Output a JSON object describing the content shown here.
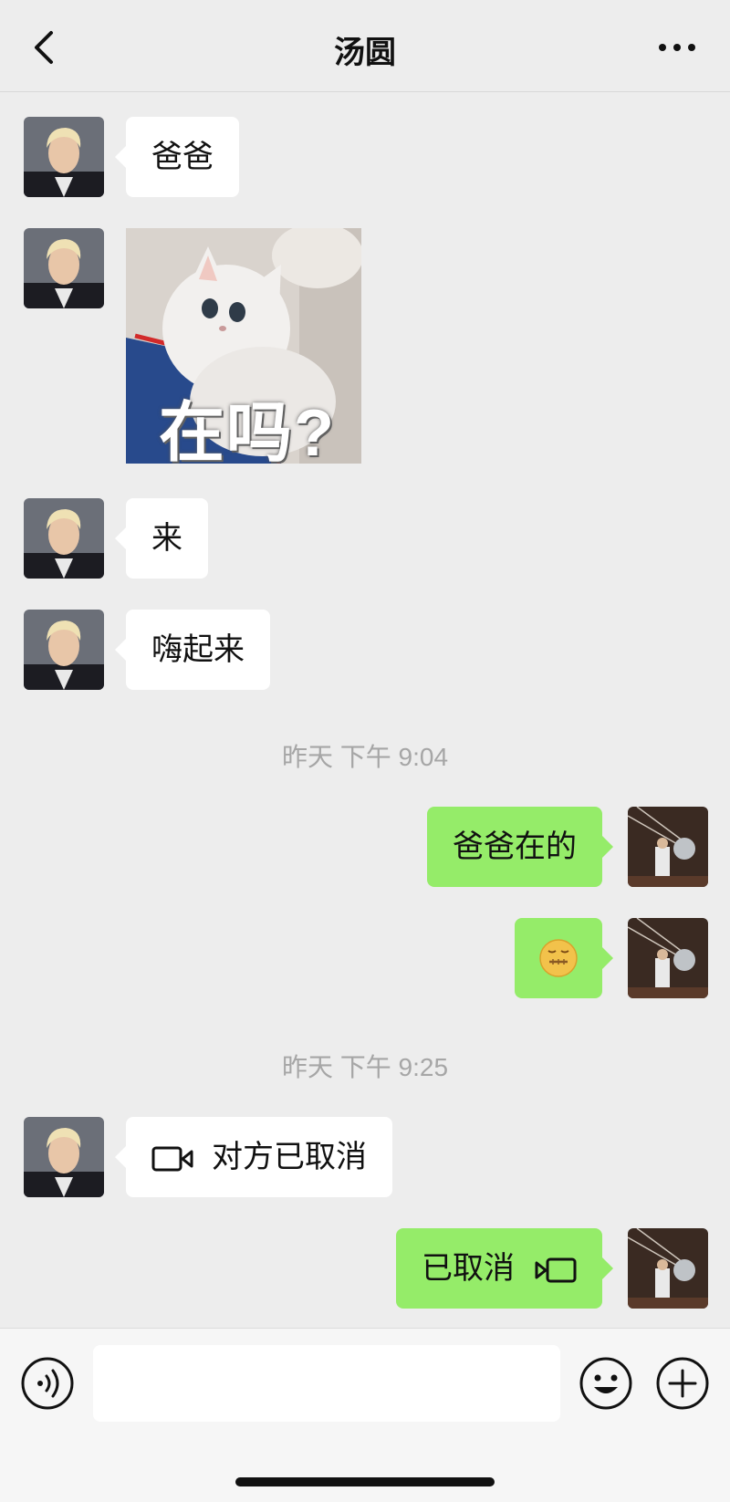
{
  "header": {
    "title": "汤圆"
  },
  "messages": {
    "m1": "爸爸",
    "m2_sticker_caption": "在吗?",
    "m3": "来",
    "m4": "嗨起来",
    "time1": "昨天 下午 9:04",
    "m5": "爸爸在的",
    "time2": "昨天 下午 9:25",
    "m7": "对方已取消",
    "m8": "已取消"
  },
  "footer": {
    "input_placeholder": ""
  },
  "icons": {
    "back": "chevron-left-icon",
    "more": "more-horizontal-icon",
    "video": "video-camera-icon",
    "voice": "voice-icon",
    "emoji": "smiley-icon",
    "plus": "plus-icon",
    "sticker_emoji": "zipper-mouth-face-icon"
  },
  "colors": {
    "background": "#ededed",
    "incoming_bubble": "#ffffff",
    "outgoing_bubble": "#95ec69",
    "timestamp": "#a6a6a6"
  }
}
